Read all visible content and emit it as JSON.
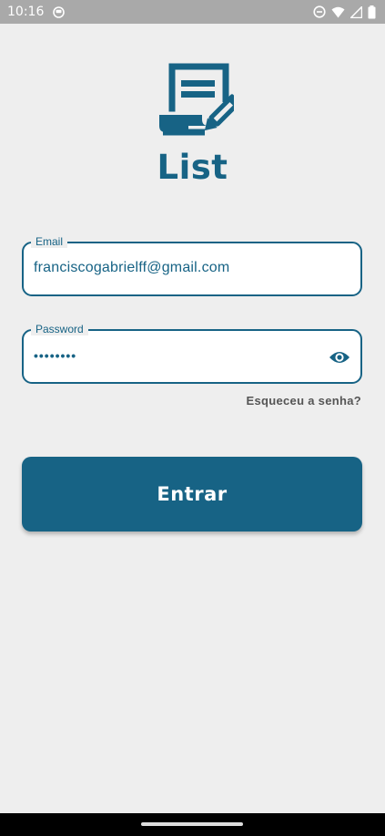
{
  "status_bar": {
    "time": "10:16"
  },
  "app": {
    "title": "List"
  },
  "email_field": {
    "label": "Email",
    "value": "franciscogabrielff@gmail.com"
  },
  "password_field": {
    "label": "Password",
    "value": "••••••••"
  },
  "forgot_link": "Esqueceu a senha?",
  "enter_button": "Entrar",
  "colors": {
    "primary": "#176385",
    "background": "#EEEEEE",
    "status_bar": "#A9A9A9"
  }
}
